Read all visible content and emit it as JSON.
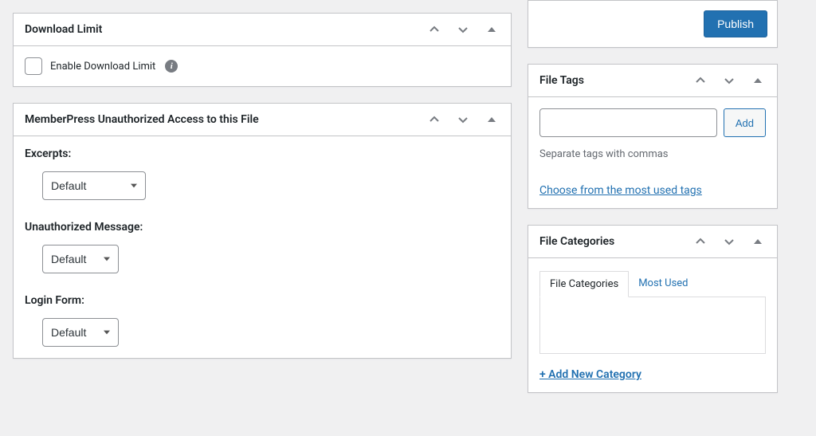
{
  "panels": {
    "download_limit": {
      "title": "Download Limit",
      "enable_label": "Enable Download Limit"
    },
    "memberpress": {
      "title": "MemberPress Unauthorized Access to this File",
      "excerpts_label": "Excerpts:",
      "excerpts_value": "Default",
      "unauth_label": "Unauthorized Message:",
      "unauth_value": "Default",
      "login_label": "Login Form:",
      "login_value": "Default"
    },
    "publish": {
      "button": "Publish"
    },
    "file_tags": {
      "title": "File Tags",
      "add_button": "Add",
      "howto": "Separate tags with commas",
      "choose_link": "Choose from the most used tags"
    },
    "file_categories": {
      "title": "File Categories",
      "tab_categories": "File Categories",
      "tab_most_used": "Most Used",
      "add_new_link": "+ Add New Category"
    }
  }
}
